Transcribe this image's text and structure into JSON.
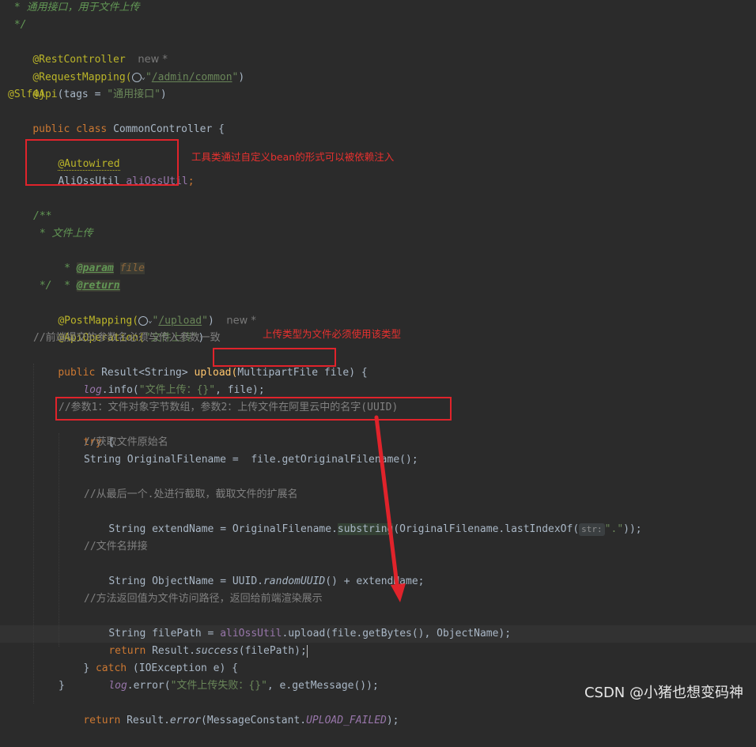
{
  "code": {
    "l01": " * 通用接口，用于文件上传",
    "l02": " */",
    "l03_ann": "@RestController",
    "l03_hint": "new *",
    "l04_ann": "@RequestMapping(",
    "l04_str_q1": "\"",
    "l04_url": "/admin/common",
    "l04_str_q2": "\"",
    "l04_end": ")",
    "l05_ann": "@Api",
    "l05_mid": "(tags = ",
    "l05_str": "\"通用接口\"",
    "l05_end": ")",
    "l06_ann": "@Slf4j",
    "l07_kw": "public class ",
    "l07_rest": "CommonController {",
    "l09_ann": "@Autowired",
    "l10_type": "AliOssUtil ",
    "l10_field": "aliOssUtil",
    "l10_semi": ";",
    "l13": "/**",
    "l14": " * 文件上传",
    "l15_pre": " * ",
    "l15_tag": "@param",
    "l15_sp": " ",
    "l15_param": "file",
    "l16_pre": " * ",
    "l16_tag": "@return",
    "l17": " */",
    "l18_ann": "@PostMapping(",
    "l18_q1": "\"",
    "l18_url": "/upload",
    "l18_q2": "\"",
    "l18_end": ")",
    "l18_hint": "new *",
    "l19_ann": "@ApiOperation(",
    "l19_str": "\"文件上传\"",
    "l19_end": ")",
    "l20": "//前端提交的参数名必须与传入参数一致",
    "l21_kw": "public ",
    "l21_a": "Result<String> ",
    "l21_m": "upload(",
    "l21_p": "MultipartFile file",
    "l21_end": ") {",
    "l22_log": "log",
    "l22_a": ".info(",
    "l22_str": "\"文件上传：{}\"",
    "l22_end": ", file);",
    "l24": "//参数1：文件对象字节数组，参数2：上传文件在阿里云中的名字(UUID)",
    "l25_kw": "try",
    "l25_end": " {",
    "l26": "//获取文件原始名",
    "l27": "String OriginalFilename =  file.getOriginalFilename();",
    "l29": "//从最后一个.处进行截取，截取文件的扩展名",
    "l30_a": "String extendName = OriginalFilename.",
    "l30_sub": "substring",
    "l30_b": "(OriginalFilename.lastIndexOf(",
    "l30_inlay": "str:",
    "l30_str": "\".\"",
    "l30_end": "));",
    "l32": "//文件名拼接",
    "l33_a": "String ObjectName = UUID.",
    "l33_m": "randomUUID",
    "l33_b": "() + extendName;",
    "l35": "//方法返回值为文件访问路径，返回给前端渲染展示",
    "l36_a": "String filePath = ",
    "l36_f": "aliOssUtil",
    "l36_b": ".upload(file.getBytes(), ObjectName);",
    "l37_kw": "return ",
    "l37_a": "Result.",
    "l37_m": "success",
    "l37_b": "(filePath);",
    "l38_a": "} ",
    "l38_kw": "catch",
    "l38_b": " (IOException e) {",
    "l39_log": "log",
    "l39_a": ".error(",
    "l39_str": "\"文件上传失败：{}\"",
    "l39_end": ", e.getMessage());",
    "l40": "}",
    "l41_kw": "return ",
    "l41_a": "Result.",
    "l41_m": "error",
    "l41_b": "(MessageConstant.",
    "l41_c": "UPLOAD_FAILED",
    "l41_end": ");"
  },
  "annotations": {
    "note1": "工具类通过自定义bean的形式可以被依赖注入",
    "note2": "上传类型为文件必须使用该类型"
  },
  "watermark": "CSDN @小猪也想变码神",
  "colors": {
    "background": "#2b2b2b",
    "keyword": "#cc7832",
    "annotation": "#bbb529",
    "string": "#6a8759",
    "comment": "#808080",
    "field": "#9876aa",
    "markup_red": "#e0232b"
  }
}
